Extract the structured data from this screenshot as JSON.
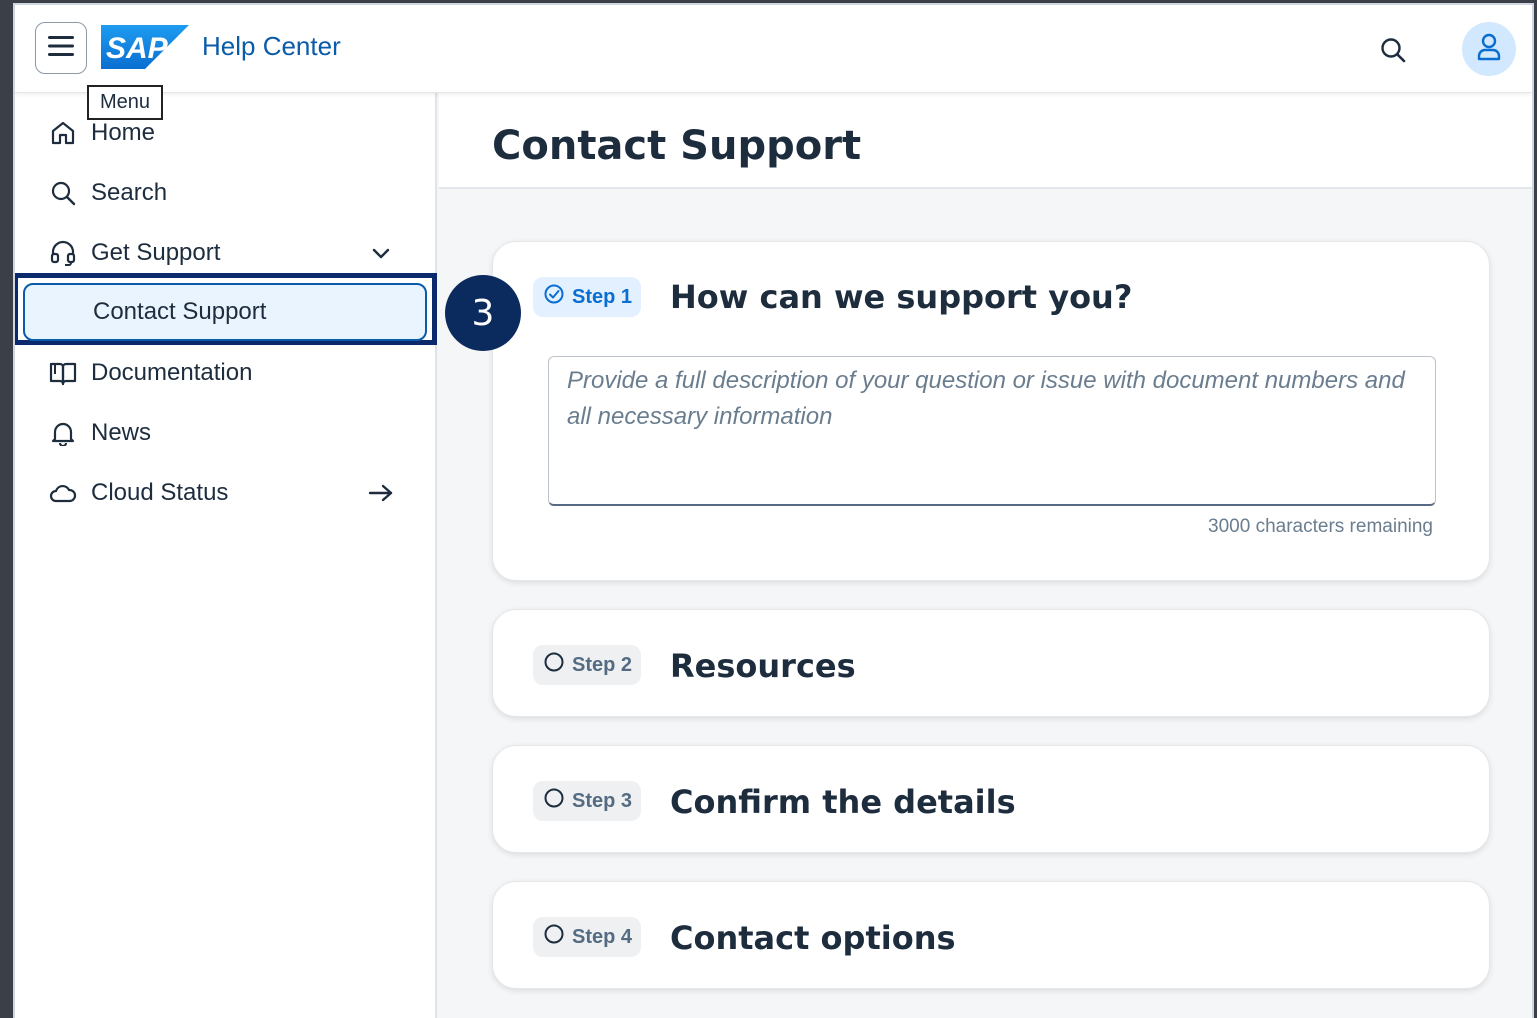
{
  "header": {
    "app_title": "Help Center",
    "logo_text": "SAP",
    "menu_tooltip": "Menu"
  },
  "sidebar": {
    "items": [
      {
        "label": "Home",
        "icon": "home-icon"
      },
      {
        "label": "Search",
        "icon": "search-icon"
      },
      {
        "label": "Get Support",
        "icon": "headset-icon",
        "trailing": "chevron-down-icon"
      },
      {
        "label": "Contact Support",
        "active": true
      },
      {
        "label": "Documentation",
        "icon": "book-icon"
      },
      {
        "label": "News",
        "icon": "bell-icon"
      },
      {
        "label": "Cloud Status",
        "icon": "cloud-icon",
        "trailing": "arrow-right-icon"
      }
    ]
  },
  "annotation": {
    "number": "3"
  },
  "main": {
    "page_title": "Contact Support",
    "steps": [
      {
        "chip": "Step 1",
        "title": "How can we support you?",
        "status": "active"
      },
      {
        "chip": "Step 2",
        "title": "Resources",
        "status": "idle"
      },
      {
        "chip": "Step 3",
        "title": "Confirm the details",
        "status": "idle"
      },
      {
        "chip": "Step 4",
        "title": "Contact options",
        "status": "idle"
      }
    ],
    "description": {
      "placeholder": "Provide a full description of your question or issue with document numbers and all necessary information",
      "value": "",
      "counter": "3000 characters remaining"
    }
  },
  "colors": {
    "accent": "#0a6ed1",
    "brand_blue": "#0a5ba8",
    "highlight_border": "#0b2a6b",
    "annotation_badge": "#0b2a5e"
  }
}
